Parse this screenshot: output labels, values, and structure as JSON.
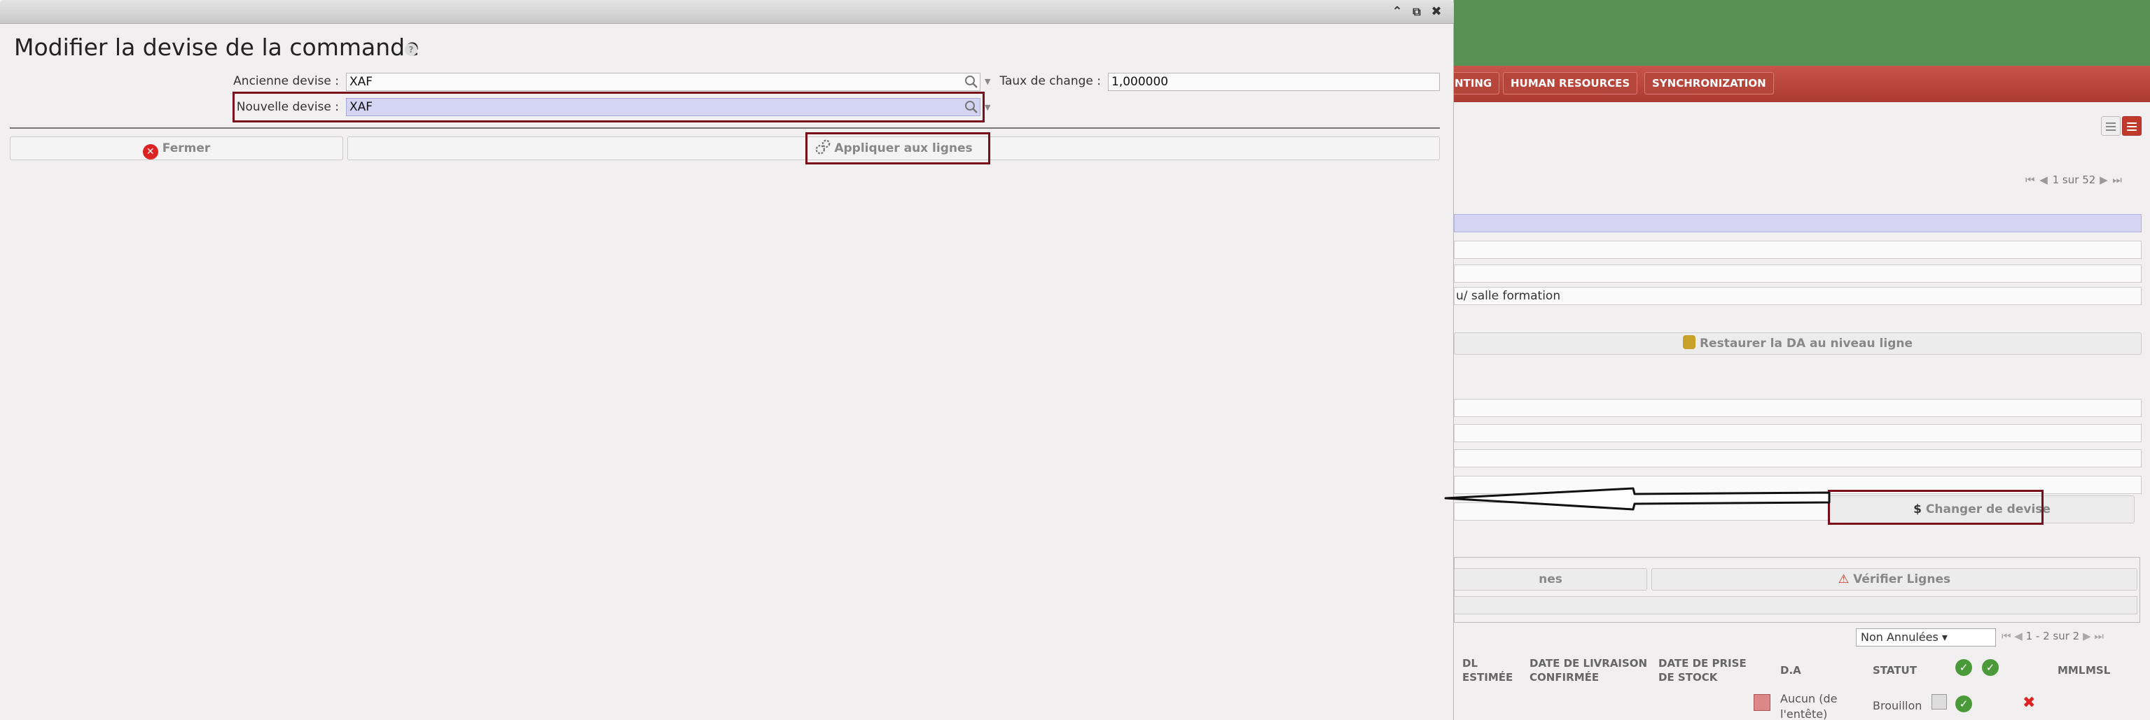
{
  "dialog": {
    "title": "Modifier la devise de la commande",
    "old_currency_label": "Ancienne devise :",
    "old_currency_value": "XAF",
    "new_currency_label": "Nouvelle devise :",
    "new_currency_value": "XAF",
    "exchange_rate_label": "Taux de change :",
    "exchange_rate_value": "1,000000",
    "close_button": "Fermer",
    "apply_button": "Appliquer aux lignes",
    "help_glyph": "?"
  },
  "background": {
    "menu": [
      "NTING",
      "HUMAN RESOURCES",
      "SYNCHRONIZATION"
    ],
    "pager_text": "1 sur 52",
    "location_text": "u/ salle formation",
    "restore_button": "Restaurer la DA au niveau ligne",
    "change_currency_button": "Changer de devise",
    "lines_button_partial": "nes",
    "verify_button": "Vérifier Lignes",
    "filter_value": "Non Annulées",
    "grid_pager": "1 - 2 sur 2",
    "columns": [
      "DL ESTIMÉE",
      "DATE DE LIVRAISON CONFIRMÉE",
      "DATE DE PRISE DE STOCK",
      "D.A",
      "STATUT",
      "MML",
      "MSL"
    ],
    "row": {
      "da": "Aucun (de l'entête)",
      "status": "Brouillon"
    }
  },
  "colors": {
    "highlight": "#7a0f1b",
    "green_header": "#589153",
    "red_menu": "#b6453c",
    "selected_field": "#d4d4f4"
  }
}
